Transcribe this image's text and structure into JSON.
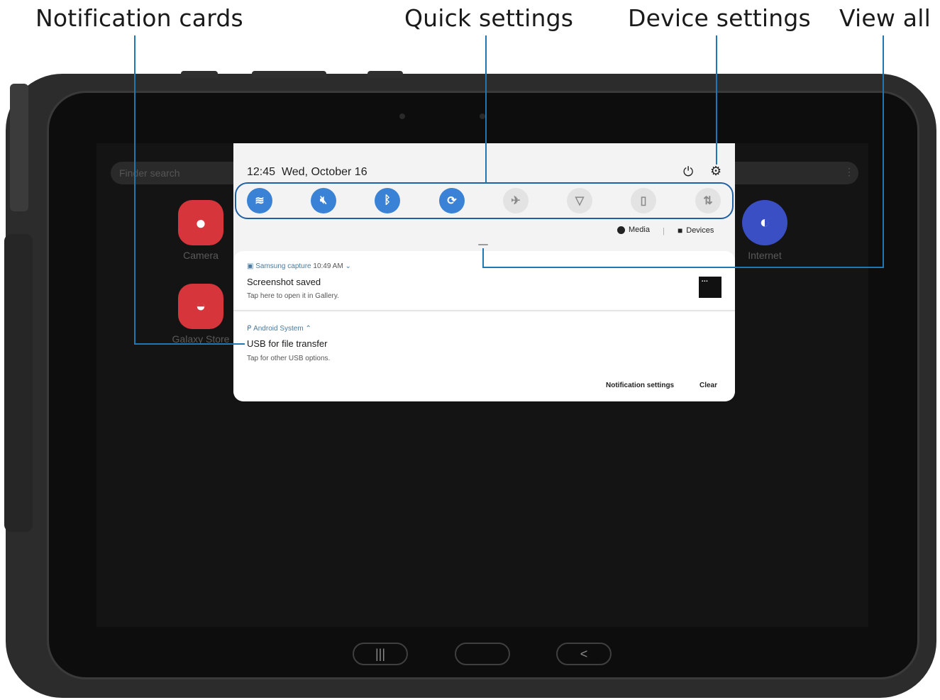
{
  "callouts": {
    "notification_cards": "Notification cards",
    "quick_settings": "Quick settings",
    "device_settings": "Device settings",
    "view_all": "View all"
  },
  "home": {
    "search_placeholder": "Finder search",
    "apps": [
      {
        "label": "Camera",
        "icon": "camera-icon",
        "color": "#d6353c"
      },
      {
        "label": "Galaxy Store",
        "icon": "store-bag-icon",
        "color": "#d6353c"
      },
      {
        "label": "Internet",
        "icon": "planet-icon",
        "color": "#3b4fc4"
      }
    ]
  },
  "panel": {
    "time": "12:45",
    "date": "Wed, October 16",
    "quick_toggles": [
      {
        "icon": "wifi-icon",
        "on": true
      },
      {
        "icon": "mute-icon",
        "on": true
      },
      {
        "icon": "bluetooth-icon",
        "on": true
      },
      {
        "icon": "auto-rotate-icon",
        "on": true
      },
      {
        "icon": "airplane-icon",
        "on": false
      },
      {
        "icon": "flashlight-icon",
        "on": false
      },
      {
        "icon": "power-saving-icon",
        "on": false
      },
      {
        "icon": "mobile-data-icon",
        "on": false
      }
    ],
    "media_label": "Media",
    "devices_label": "Devices",
    "notifications": [
      {
        "app": "Samsung capture",
        "time": "10:49 AM",
        "title": "Screenshot saved",
        "text": "Tap here to open it in Gallery."
      },
      {
        "app": "Android System",
        "title": "USB for file transfer",
        "text": "Tap for other USB options."
      }
    ],
    "notification_settings": "Notification settings",
    "clear": "Clear"
  },
  "colors": {
    "accent": "#3a82d6",
    "callout_line": "#1f77b4",
    "outline": "#1f5fa3"
  }
}
